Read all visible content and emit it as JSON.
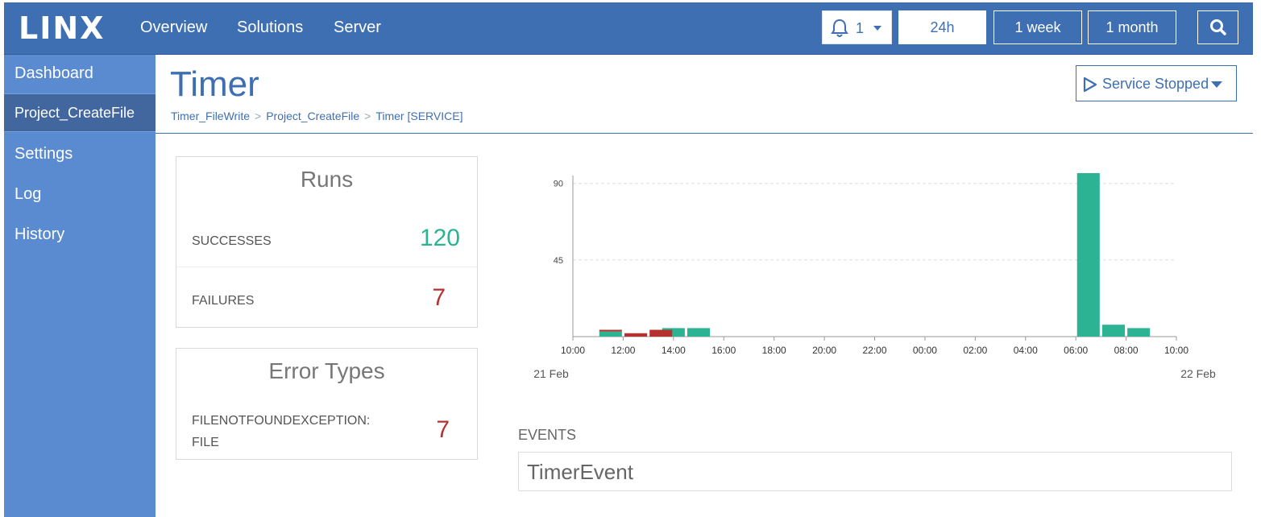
{
  "app": {
    "logo": "LINX"
  },
  "nav": {
    "items": [
      "Overview",
      "Solutions",
      "Server"
    ]
  },
  "notifications": {
    "count": "1"
  },
  "time_range": {
    "options": [
      "24h",
      "1 week",
      "1 month"
    ],
    "selected": "24h"
  },
  "sidebar": {
    "items": [
      {
        "label": "Dashboard"
      },
      {
        "label": "Project_CreateFile",
        "active": true
      },
      {
        "label": "Settings"
      },
      {
        "label": "Log"
      },
      {
        "label": "History"
      }
    ]
  },
  "page": {
    "title": "Timer",
    "breadcrumb": [
      "Timer_FileWrite",
      "Project_CreateFile",
      "Timer [SERVICE]"
    ],
    "breadcrumb_sep": ">",
    "service_status": "Service Stopped"
  },
  "runs": {
    "title": "Runs",
    "successes_label": "SUCCESSES",
    "successes": "120",
    "failures_label": "FAILURES",
    "failures": "7"
  },
  "error_types": {
    "title": "Error Types",
    "items": [
      {
        "label_line1": "FILENOTFOUNDEXCEPTION:",
        "label_line2": "FILE",
        "count": "7"
      }
    ]
  },
  "events": {
    "label": "EVENTS",
    "items": [
      "TimerEvent"
    ]
  },
  "colors": {
    "success": "#2bb394",
    "failure": "#b5312f",
    "brand": "#3e6fb3"
  },
  "chart_data": {
    "type": "bar",
    "stacked": true,
    "x_tick_labels": [
      "10:00",
      "12:00",
      "14:00",
      "16:00",
      "18:00",
      "20:00",
      "22:00",
      "00:00",
      "02:00",
      "04:00",
      "06:00",
      "08:00",
      "10:00"
    ],
    "date_labels": [
      "21 Feb",
      "22 Feb"
    ],
    "y_ticks": [
      45,
      90
    ],
    "ylim": [
      0,
      96
    ],
    "grid": true,
    "x_range_hours": [
      0,
      24
    ],
    "series": [
      {
        "name": "",
        "color": "#2bb394",
        "points": [
          [
            1.5,
            3
          ],
          [
            4,
            5
          ],
          [
            5,
            5
          ],
          [
            20.5,
            96
          ],
          [
            21.5,
            7
          ],
          [
            22.5,
            5
          ]
        ]
      },
      {
        "name": "",
        "color": "#b5312f",
        "points": [
          [
            1.5,
            1
          ],
          [
            2.5,
            2
          ],
          [
            3.5,
            4
          ]
        ]
      }
    ]
  }
}
